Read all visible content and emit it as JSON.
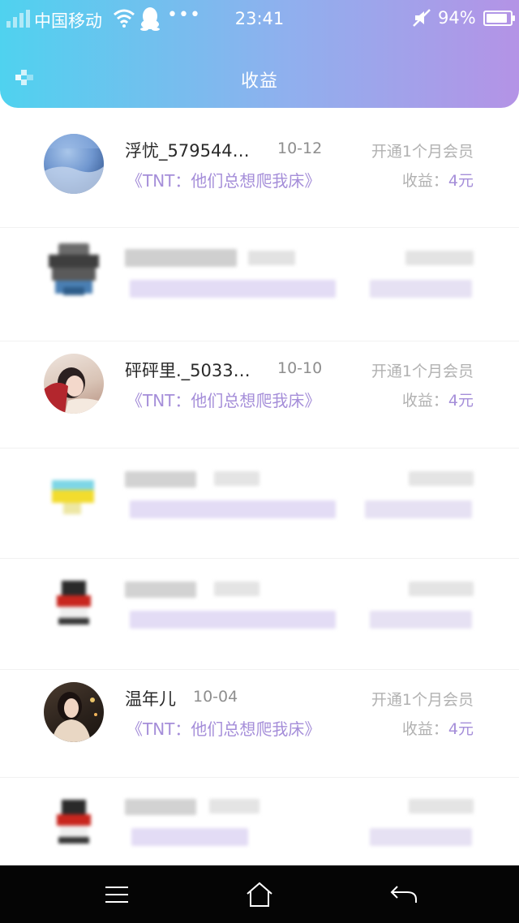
{
  "status_bar": {
    "carrier": "中国移动",
    "more": "•••",
    "time": "23:41",
    "battery": "94%"
  },
  "header": {
    "title": "收益",
    "back_icon": "back-arrow-icon"
  },
  "rows": [
    {
      "name": "浮忧_579544…",
      "date": "10-12",
      "action": "开通1个月会员",
      "book": "《TNT：他们总想爬我床》",
      "earn_label": "收益：",
      "earn_value": "4元",
      "avatar": "sky-photo"
    },
    {
      "name": "砰砰里._5033…",
      "date": "10-10",
      "action": "开通1个月会员",
      "book": "《TNT：他们总想爬我床》",
      "earn_label": "收益：",
      "earn_value": "4元",
      "avatar": "girl-photo"
    },
    {
      "name": "温年儿",
      "date": "10-04",
      "action": "开通1个月会员",
      "book": "《TNT：他们总想爬我床》",
      "earn_label": "收益：",
      "earn_value": "4元",
      "avatar": "girl-photo-2"
    }
  ],
  "navbar": {
    "menu_icon": "menu-icon",
    "home_icon": "home-icon",
    "back_icon": "back-icon"
  },
  "colors": {
    "header_gradient_start": "#4fd2ef",
    "header_gradient_end": "#b493e6",
    "accent_purple": "#a58ed9"
  }
}
